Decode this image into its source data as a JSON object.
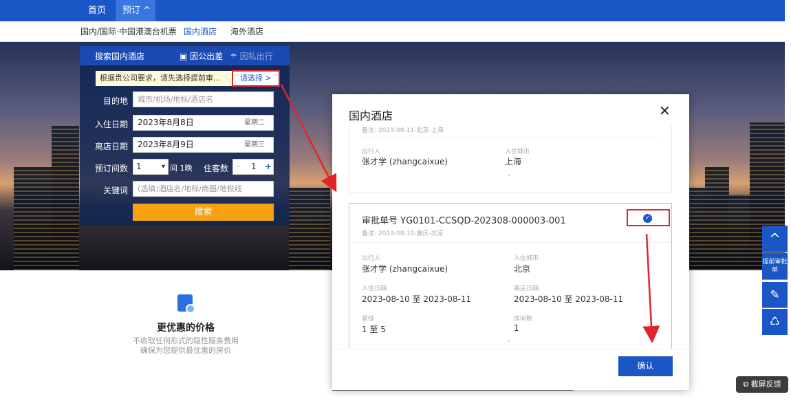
{
  "nav": {
    "home": "首页",
    "booking": "预订 ^"
  },
  "subnav": {
    "flights": "国内/国际·中国港澳台机票",
    "domestic_hotel": "国内酒店",
    "overseas_hotel": "海外酒店"
  },
  "search": {
    "title": "搜索国内酒店",
    "tab_business": "因公出差",
    "tab_private": "因私出行",
    "notice": "根据贵公司要求，请先选择提前审...",
    "select_btn": "请选择 >",
    "dest_label": "目的地",
    "dest_placeholder": "城市/机场/地标/酒店名",
    "checkin_label": "入住日期",
    "checkin_value": "2023年8月8日",
    "checkin_week": "星期二",
    "checkout_label": "离店日期",
    "checkout_value": "2023年8月9日",
    "checkout_week": "星期三",
    "rooms_label": "预订间数",
    "rooms_value": "1",
    "nights": "间 1晚",
    "guests_label": "住客数",
    "guests_minus": "-",
    "guests_value": "1",
    "guests_plus": "+",
    "keyword_label": "关键词",
    "keyword_placeholder": "(选填)酒店名/地标/商圈/地铁线",
    "search_btn": "搜索"
  },
  "feature": {
    "title": "更优惠的价格",
    "line1": "不收取任何形式的隐性服务费用",
    "line2": "确保为您提供最优惠的房价"
  },
  "modal": {
    "title": "国内酒店",
    "close": "✕",
    "card1": {
      "remark": "备注: 2023-08-11-北京-上海",
      "traveler_label": "出行人",
      "traveler": "张才学 (zhangcaixue)",
      "city_label": "入住城市",
      "city": "上海",
      "chevron": "⌄"
    },
    "card2": {
      "approval": "审批单号  YG0101-CCSQD-202308-000003-001",
      "remark": "备注: 2023-08-10-重庆-北京",
      "traveler_label": "出行人",
      "traveler": "张才学 (zhangcaixue)",
      "city_label": "入住城市",
      "city": "北京",
      "checkin_label": "入住日期",
      "checkin": "2023-08-10 至 2023-08-11",
      "checkout_label": "离店日期",
      "checkout": "2023-08-10 至 2023-08-11",
      "star_label": "星级",
      "star": "1 至 5",
      "rooms_label": "房间数",
      "rooms": "1",
      "chevron": "⌃"
    },
    "confirm": "确认"
  },
  "tools": {
    "up": "^",
    "approval": "提前审批单",
    "edit": "✎",
    "service": "♺"
  },
  "feedback": "⧉ 截屏反馈",
  "colors": {
    "primary": "#1a56c6",
    "highlight": "#e2242a",
    "search": "#f8a10f"
  }
}
